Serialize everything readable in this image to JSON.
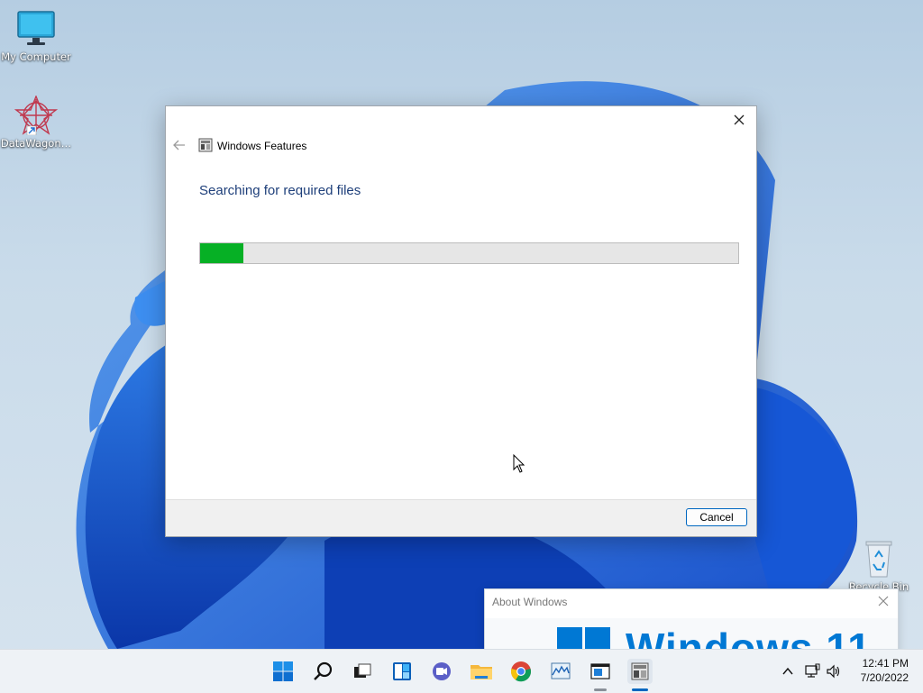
{
  "desktop": {
    "icons": [
      {
        "label": "My Computer",
        "icon": "monitor-icon"
      },
      {
        "label": "DataWagon…",
        "icon": "datawagon-shortcut-icon"
      },
      {
        "label": "Recycle Bin",
        "icon": "recycle-bin-icon"
      }
    ]
  },
  "dialog": {
    "title": "Windows Features",
    "heading": "Searching for required files",
    "progress": 0.08,
    "progress_color": "#06b025",
    "cancel_label": "Cancel"
  },
  "about_window": {
    "title": "About Windows",
    "wordmark": "Windows 11"
  },
  "taskbar": {
    "apps": [
      {
        "name": "start-button",
        "icon": "windows-logo-icon"
      },
      {
        "name": "search-button",
        "icon": "search-icon"
      },
      {
        "name": "task-view-button",
        "icon": "task-view-icon"
      },
      {
        "name": "widgets-button",
        "icon": "widgets-icon"
      },
      {
        "name": "chat-button",
        "icon": "chat-icon"
      },
      {
        "name": "file-explorer-button",
        "icon": "folder-icon"
      },
      {
        "name": "chrome-button",
        "icon": "chrome-icon"
      },
      {
        "name": "performance-monitor-button",
        "icon": "performance-monitor-icon"
      },
      {
        "name": "about-windows-button",
        "icon": "window-icon"
      },
      {
        "name": "windows-features-button",
        "icon": "windows-features-icon"
      }
    ],
    "clock": {
      "time": "12:41 PM",
      "date": "7/20/2022"
    }
  },
  "colors": {
    "accent": "#0067c0",
    "wallpaper_bloom": "#1f6fe0",
    "heading_text": "#1e3f7a"
  }
}
